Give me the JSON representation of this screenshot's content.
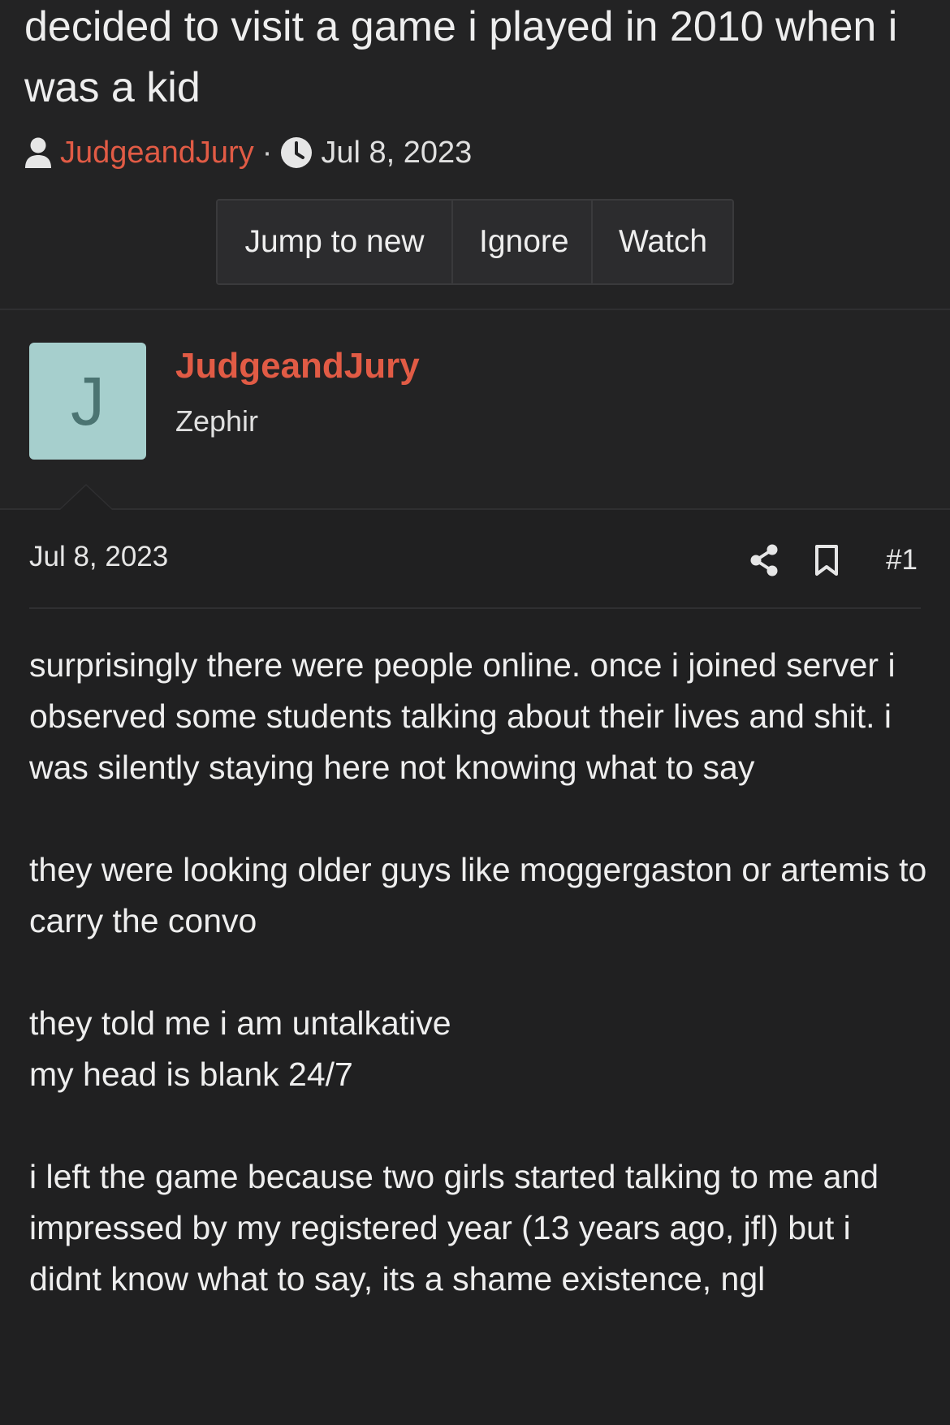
{
  "thread": {
    "title": "decided to visit a game i played in 2010 when i was a kid",
    "author": "JudgeandJury",
    "separator": "·",
    "date": "Jul 8, 2023",
    "buttons": {
      "jump_to_new": "Jump to new",
      "ignore": "Ignore",
      "watch": "Watch"
    }
  },
  "post": {
    "avatar_letter": "J",
    "user_name": "JudgeandJury",
    "user_title": "Zephir",
    "date": "Jul 8, 2023",
    "number": "#1",
    "paragraphs": [
      [
        "surprisingly there were people online. once i joined server i observed some students talking about their lives and shit. i was silently staying here not knowing what to say"
      ],
      [
        "they were looking older guys like moggergaston or artemis to carry the convo"
      ],
      [
        "they told me i am untalkative",
        "my head is blank 24/7"
      ],
      [
        "i left the game because two girls started talking to me and impressed by my registered year (13 years ago, jfl) but i didnt know what to say, its a shame existence, ngl"
      ]
    ]
  },
  "icons": {
    "user": "user-icon",
    "clock": "clock-icon",
    "share": "share-icon",
    "bookmark": "bookmark-icon"
  },
  "colors": {
    "background": "#232324",
    "post_background": "#202021",
    "accent": "#e15b45",
    "avatar_bg": "#a6cfcd",
    "avatar_fg": "#4b7472"
  }
}
